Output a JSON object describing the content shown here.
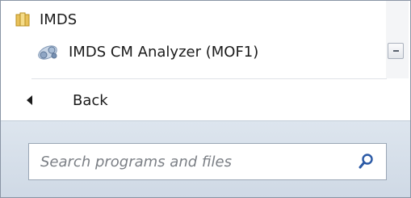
{
  "folder": {
    "label": "IMDS",
    "icon": "folder-icon"
  },
  "program": {
    "label": "IMDS CM Analyzer (MOF1)",
    "icon": "app-icon"
  },
  "scrollbar": {
    "icon": "scroll-collapse-icon"
  },
  "back": {
    "label": "Back",
    "icon": "back-arrow-icon"
  },
  "search": {
    "placeholder": "Search programs and files",
    "value": "",
    "icon": "search-icon"
  },
  "colors": {
    "footer_bg": "#d6dfe9",
    "text": "#1b1b1b",
    "search_icon": "#2b5aa6"
  }
}
